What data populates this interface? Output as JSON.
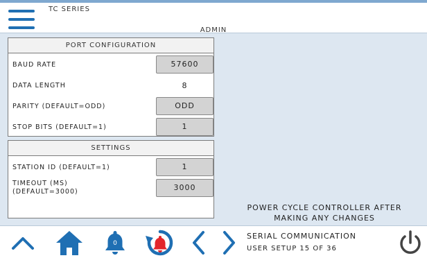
{
  "header": {
    "series": "TC SERIES",
    "user": "ADMIN"
  },
  "port_configuration": {
    "title": "PORT CONFIGURATION",
    "rows": [
      {
        "label": "BAUD RATE",
        "value": "57600",
        "editable": true
      },
      {
        "label": "DATA LENGTH",
        "value": "8",
        "editable": false
      },
      {
        "label": "PARITY (DEFAULT=ODD)",
        "value": "ODD",
        "editable": true
      },
      {
        "label": "STOP BITS (DEFAULT=1)",
        "value": "1",
        "editable": true
      }
    ]
  },
  "settings": {
    "title": "SETTINGS",
    "rows": [
      {
        "label": "STATION ID (DEFAULT=1)",
        "value": "1",
        "editable": true
      },
      {
        "label_line1": "TIMEOUT (MS)",
        "label_line2": "(DEFAULT=3000)",
        "value": "3000",
        "editable": true
      }
    ]
  },
  "note": {
    "line1": "POWER CYCLE CONTROLLER AFTER",
    "line2": "MAKING ANY CHANGES"
  },
  "footer": {
    "title": "SERIAL COMMUNICATION",
    "subtitle": "USER SETUP 15 OF 36",
    "alarm_badge": "0",
    "icons": [
      "chevron-up-icon",
      "home-icon",
      "bell-icon",
      "alarm-reset-icon",
      "chevron-left-icon",
      "chevron-right-icon",
      "power-icon"
    ]
  },
  "colors": {
    "accent": "#1f6fb3",
    "alarm": "#e3262b",
    "background": "#dde7f1",
    "value_box": "#d3d3d3"
  }
}
